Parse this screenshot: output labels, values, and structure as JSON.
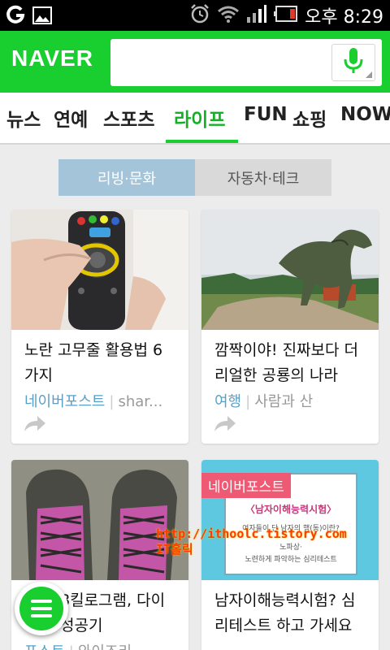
{
  "status_bar": {
    "time_label": "오후 8:29",
    "icons": [
      "notification-o-icon",
      "image-icon",
      "alarm-icon",
      "wifi-icon",
      "signal-icon",
      "battery-icon"
    ]
  },
  "header": {
    "logo": "NAVER",
    "search_value": "",
    "brand_color": "#19ce2f"
  },
  "tabs": [
    {
      "label": "뉴스"
    },
    {
      "label": "연예"
    },
    {
      "label": "스포츠"
    },
    {
      "label": "라이프",
      "active": true
    },
    {
      "label": "FUN"
    },
    {
      "label": "쇼핑"
    },
    {
      "label": "NOW"
    }
  ],
  "segment": {
    "active": "리빙·문화",
    "inactive": "자동차·테크"
  },
  "cards": [
    {
      "title": "노란 고무줄 활용법 6 가지",
      "source": "네이버포스트",
      "sub": "shar..."
    },
    {
      "title": "깜짝이야! 진짜보다 더 리얼한 공룡의 나라",
      "source": "여행",
      "sub": "사람과 산"
    },
    {
      "title": "8킬로그램, 다이 성공기",
      "source": "포스트",
      "sub": "와이즈리"
    },
    {
      "title": "남자이해능력시험? 심리테스트 하고 가세요",
      "badge": "네이버포스트",
      "image_heading": "〈남자이해능력시험〉",
      "image_text_1": "여자들이 단 남자의 행(동)이란?",
      "image_text_2": "노파상·",
      "image_text_3": "노련하게 파악하는 심리테스트"
    }
  ],
  "watermark": {
    "line1": "http://ithoolc.tistory.com",
    "line2": "IT홀릭"
  }
}
